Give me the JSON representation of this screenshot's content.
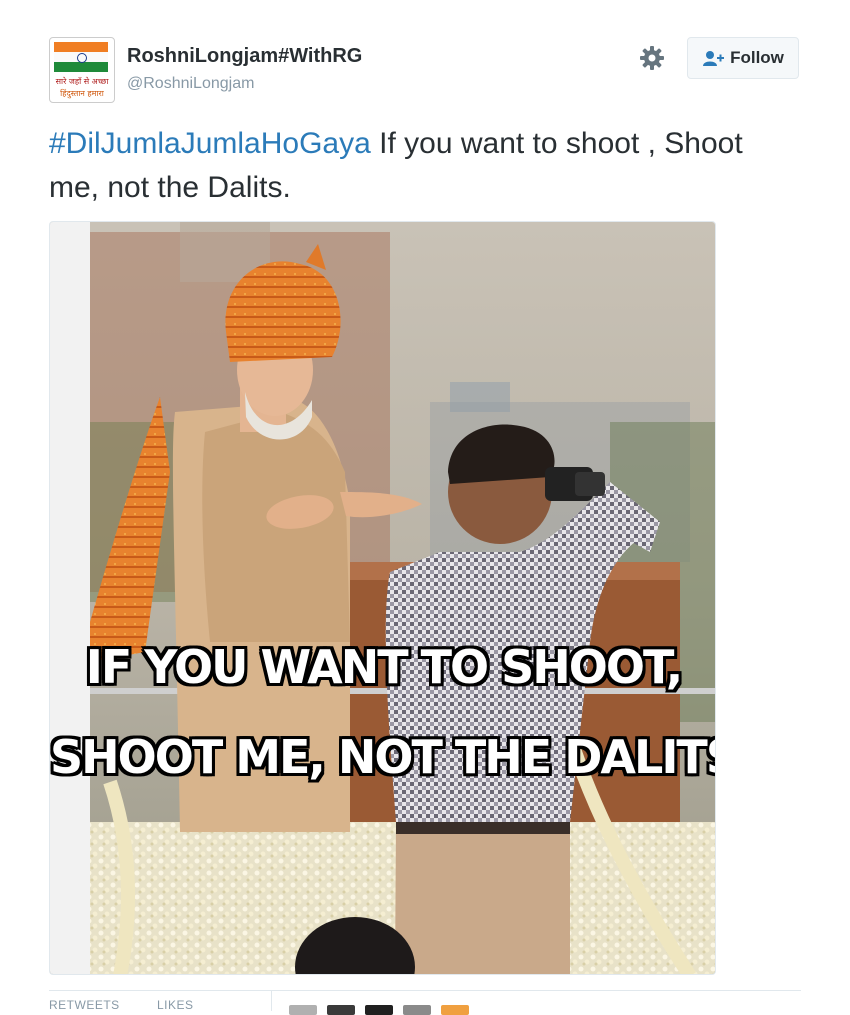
{
  "tweet": {
    "display_name": "RoshniLongjam#WithRG",
    "handle": "@RoshniLongjam",
    "avatar_text_line1": "सारे जहाँ से अच्छा",
    "avatar_text_line2": "हिंदुस्तान हमारा",
    "hashtag": "#DilJumlaJumlaHoGaya",
    "text": " If you want to  shoot , Shoot me, not the Dalits.",
    "follow_label": "Follow",
    "icons": {
      "settings": "gear-icon",
      "follow": "add-user-icon"
    }
  },
  "media": {
    "caption_line1": "IF YOU WANT TO SHOOT,",
    "caption_line2": "SHOOT ME, NOT THE DALITS."
  },
  "stats": {
    "retweets_label": "RETWEETS",
    "likes_label": "LIKES"
  },
  "colors": {
    "link": "#2b7bb9",
    "text": "#292f33",
    "muted": "#8899a6",
    "border": "#e1e8ed"
  }
}
